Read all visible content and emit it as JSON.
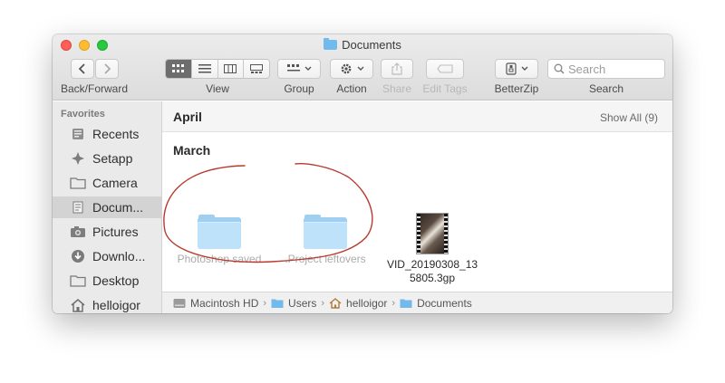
{
  "window": {
    "title": "Documents"
  },
  "toolbar": {
    "back_forward_label": "Back/Forward",
    "view_label": "View",
    "group_label": "Group",
    "action_label": "Action",
    "share_label": "Share",
    "edit_tags_label": "Edit Tags",
    "betterzip_label": "BetterZip",
    "search_label": "Search",
    "search_placeholder": "Search",
    "active_view": "icon"
  },
  "sidebar": {
    "section": "Favorites",
    "items": [
      {
        "label": "Recents",
        "icon": "recents-icon"
      },
      {
        "label": "Setapp",
        "icon": "setapp-icon"
      },
      {
        "label": "Camera",
        "icon": "folder-icon"
      },
      {
        "label": "Docum...",
        "icon": "documents-icon",
        "selected": true
      },
      {
        "label": "Pictures",
        "icon": "camera-icon"
      },
      {
        "label": "Downlo...",
        "icon": "download-icon"
      },
      {
        "label": "Desktop",
        "icon": "desktop-icon"
      },
      {
        "label": "helloigor",
        "icon": "home-icon"
      }
    ]
  },
  "content": {
    "groups": [
      {
        "name": "April",
        "show_all": "Show All (9)"
      },
      {
        "name": "March"
      }
    ],
    "files": [
      {
        "label": "Photoshop saved",
        "kind": "folder",
        "dimmed": true
      },
      {
        "label": ".Project leftovers",
        "kind": "folder",
        "dimmed": true
      },
      {
        "label_line1": "VID_20190308_13",
        "label_line2": "5805.3gp",
        "kind": "video",
        "dimmed": false
      }
    ]
  },
  "pathbar": {
    "crumbs": [
      "Macintosh HD",
      "Users",
      "helloigor",
      "Documents"
    ]
  },
  "colors": {
    "folder_blue": "#bee2fa",
    "annotation_red": "#c0392b",
    "selection_gray": "#d3d3d3"
  }
}
